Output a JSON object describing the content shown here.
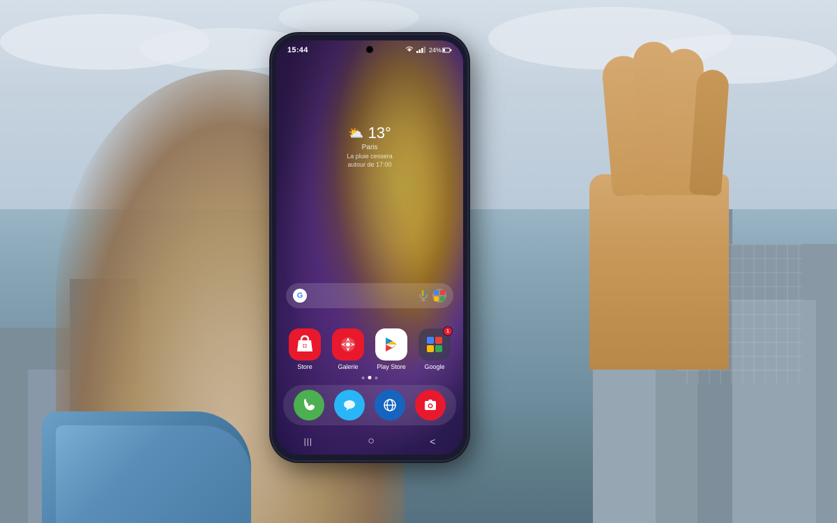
{
  "scene": {
    "bg_sky_color": "#c8d8e8",
    "bg_buildings_color": "#7a8d96"
  },
  "phone": {
    "status_bar": {
      "time": "15:44",
      "battery": "24%",
      "signal_bars": "▂▄▆",
      "wifi_icon": "wifi",
      "battery_icon": "battery"
    },
    "weather": {
      "icon": "⛅",
      "temperature": "13°",
      "city": "Paris",
      "description_line1": "La pluie cessera",
      "description_line2": "autour de 17:00"
    },
    "search_bar": {
      "google_letter": "G",
      "mic_icon": "mic",
      "lens_icon": "lens"
    },
    "apps": [
      {
        "id": "store",
        "label": "Store",
        "icon_type": "store",
        "badge": null
      },
      {
        "id": "galerie",
        "label": "Galerie",
        "icon_type": "galerie",
        "badge": null
      },
      {
        "id": "playstore",
        "label": "Play Store",
        "icon_type": "playstore",
        "badge": null
      },
      {
        "id": "google",
        "label": "Google",
        "icon_type": "google",
        "badge": "1"
      }
    ],
    "dock": [
      {
        "id": "phone",
        "icon_type": "phone",
        "emoji": "📞"
      },
      {
        "id": "messages",
        "icon_type": "messages",
        "emoji": "💬"
      },
      {
        "id": "internet",
        "icon_type": "internet",
        "emoji": "🌐"
      },
      {
        "id": "camera",
        "icon_type": "camera",
        "emoji": "📷"
      }
    ],
    "page_dots": [
      {
        "active": false
      },
      {
        "active": true
      },
      {
        "active": false
      }
    ],
    "nav": {
      "recent": "|||",
      "home": "○",
      "back": "<"
    }
  }
}
